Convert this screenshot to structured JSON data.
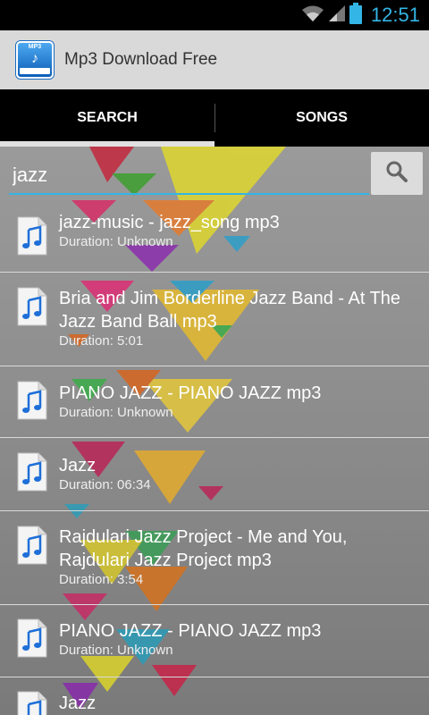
{
  "status_bar": {
    "time": "12:51",
    "icons": [
      "wifi-icon",
      "signal-icon",
      "battery-icon"
    ]
  },
  "action_bar": {
    "title": "Mp3 Download Free",
    "icon_badge": "MP3"
  },
  "tabs": [
    {
      "label": "SEARCH",
      "active": true
    },
    {
      "label": "SONGS",
      "active": false
    }
  ],
  "search": {
    "value": "jazz",
    "button_icon": "search-icon"
  },
  "results": [
    {
      "title": "jazz-music - jazz_song mp3",
      "duration": "Duration: Unknown"
    },
    {
      "title": "Bria and Jim Borderline Jazz Band - At The Jazz Band Ball mp3",
      "duration": "Duration: 5:01"
    },
    {
      "title": "PIANO JAZZ - PIANO JAZZ mp3",
      "duration": "Duration: Unknown"
    },
    {
      "title": "Jazz",
      "duration": "Duration: 06:34"
    },
    {
      "title": "Rajdulari Jazz Project - Me and You, Rajdulari Jazz Project mp3",
      "duration": "Duration: 3:54"
    },
    {
      "title": "PIANO JAZZ - PIANO JAZZ mp3",
      "duration": "Duration: Unknown"
    },
    {
      "title": "Jazz",
      "duration": ""
    }
  ],
  "colors": {
    "accent": "#33b5e5",
    "status_bar": "#000000",
    "action_bar": "#d9d9d9",
    "tab_bar": "#000000"
  }
}
